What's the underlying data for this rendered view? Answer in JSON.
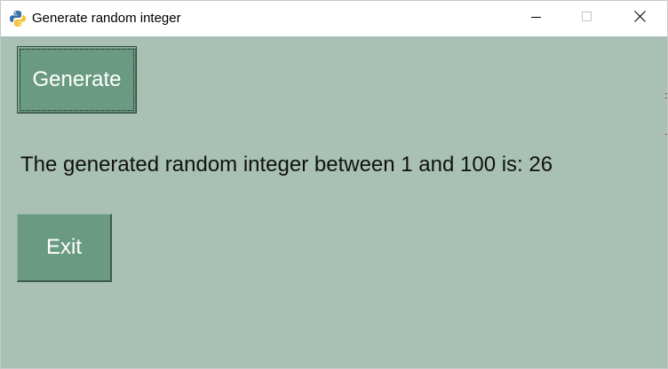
{
  "window": {
    "title": "Generate random integer",
    "icons": {
      "app": "python-icon",
      "minimize": "minimize-icon",
      "maximize": "maximize-icon",
      "close": "close-icon"
    }
  },
  "main": {
    "generate_button_label": "Generate",
    "result_text": "The generated random integer between 1 and 100 is: 26",
    "exit_button_label": "Exit"
  },
  "colors": {
    "background": "#a8c1b4",
    "button": "#6a9b82",
    "button_text": "#ffffff",
    "text": "#111111"
  }
}
